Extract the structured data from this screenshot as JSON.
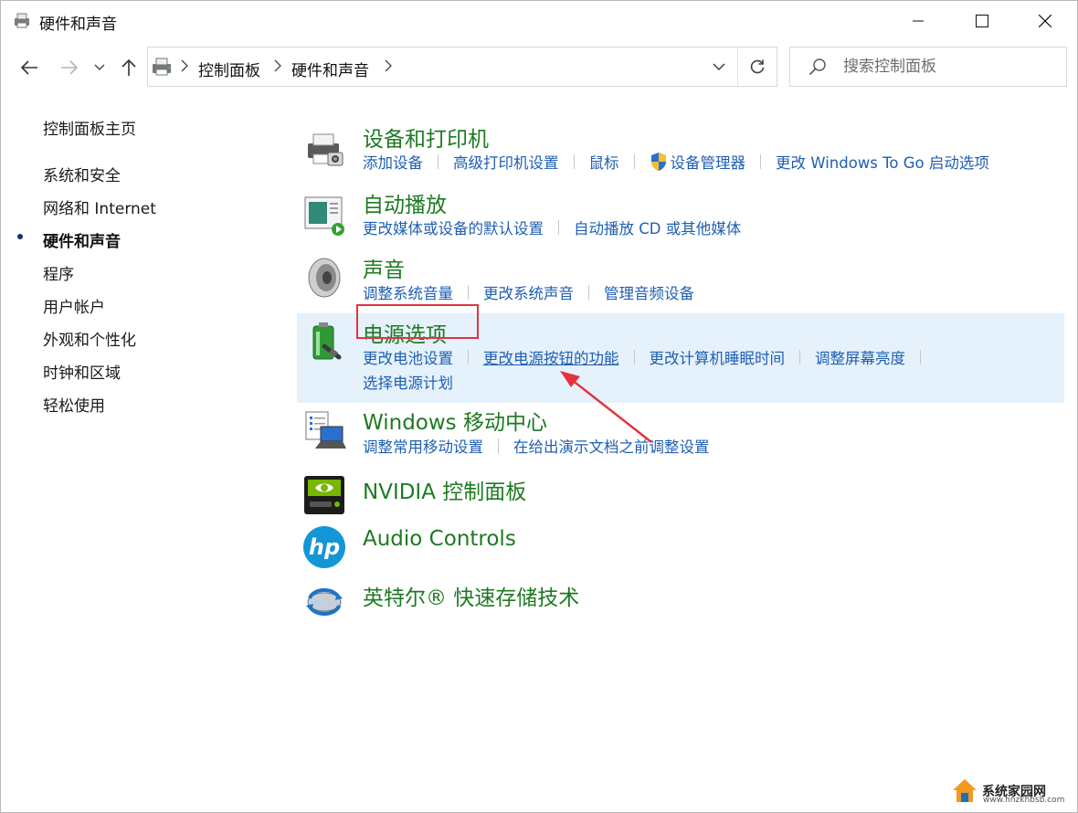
{
  "window": {
    "title": "硬件和声音"
  },
  "address": {
    "crumbs": [
      "控制面板",
      "硬件和声音"
    ]
  },
  "search": {
    "placeholder": "搜索控制面板"
  },
  "sidebar": {
    "items": [
      {
        "label": "控制面板主页"
      },
      {
        "label": "系统和安全"
      },
      {
        "label": "网络和 Internet"
      },
      {
        "label": "硬件和声音",
        "current": true
      },
      {
        "label": "程序"
      },
      {
        "label": "用户帐户"
      },
      {
        "label": "外观和个性化"
      },
      {
        "label": "时钟和区域"
      },
      {
        "label": "轻松使用"
      }
    ]
  },
  "categories": [
    {
      "title": "设备和打印机",
      "icon": "printer-icon",
      "links": [
        "添加设备",
        "高级打印机设置",
        "鼠标",
        "设备管理器",
        "更改 Windows To Go 启动选项"
      ]
    },
    {
      "title": "自动播放",
      "icon": "autoplay-icon",
      "links": [
        "更改媒体或设备的默认设置",
        "自动播放 CD 或其他媒体"
      ]
    },
    {
      "title": "声音",
      "icon": "speaker-icon",
      "links": [
        "调整系统音量",
        "更改系统声音",
        "管理音频设备"
      ]
    },
    {
      "title": "电源选项",
      "icon": "battery-icon",
      "highlighted": true,
      "links": [
        "更改电池设置",
        "更改电源按钮的功能",
        "更改计算机睡眠时间",
        "调整屏幕亮度",
        "选择电源计划"
      ]
    },
    {
      "title": "Windows 移动中心",
      "icon": "mobility-center-icon",
      "links": [
        "调整常用移动设置",
        "在给出演示文档之前调整设置"
      ]
    },
    {
      "title": "NVIDIA 控制面板",
      "icon": "nvidia-icon",
      "links": []
    },
    {
      "title": "Audio Controls",
      "icon": "hp-logo-icon",
      "links": []
    },
    {
      "title": "英特尔® 快速存储技术",
      "icon": "intel-rst-icon",
      "links": []
    }
  ],
  "colors": {
    "category_title": "#1e7a22",
    "link": "#1f5fb3",
    "highlight_bg": "#e5f1fb",
    "annotation_red": "#e3333d"
  },
  "watermark": {
    "text": "系统家园网",
    "url": "www.hnzkhbsb.com"
  }
}
